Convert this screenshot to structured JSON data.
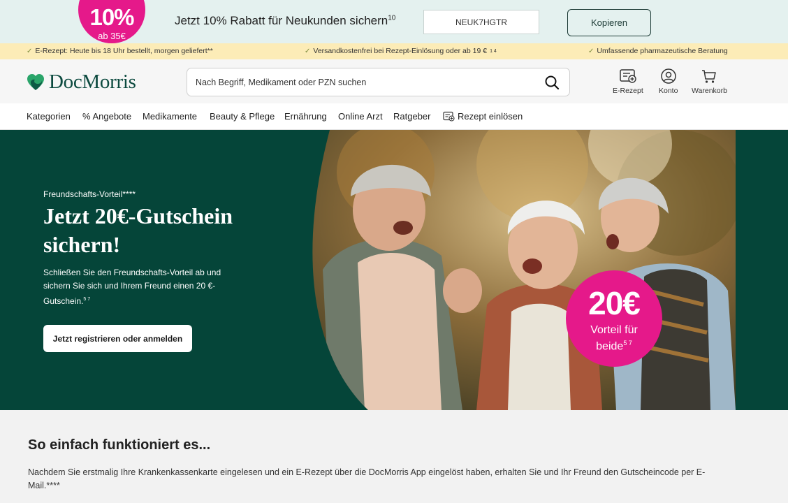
{
  "promo": {
    "badge_big": "10%",
    "badge_small": "ab 35€",
    "text": "Jetzt 10% Rabatt für Neukunden sichern",
    "text_sup": "10",
    "code": "NEUK7HGTR",
    "copy_label": "Kopieren"
  },
  "usp": {
    "items": [
      {
        "text": "E-Rezept: Heute bis 18 Uhr bestellt, morgen geliefert**",
        "sup": ""
      },
      {
        "text": "Versandkostenfrei bei Rezept-Einlösung oder ab 19 €",
        "sup": "1 4"
      },
      {
        "text": "Umfassende pharmazeutische Beratung",
        "sup": ""
      }
    ]
  },
  "header": {
    "logo": "DocMorris",
    "search_placeholder": "Nach Begriff, Medikament oder PZN suchen",
    "actions": {
      "erezept": "E-Rezept",
      "konto": "Konto",
      "warenkorb": "Warenkorb"
    }
  },
  "nav": {
    "items": [
      "Kategorien",
      "% Angebote",
      "Medikamente",
      "Beauty & Pflege",
      "Ernährung",
      "Online Arzt",
      "Ratgeber",
      "Rezept einlösen"
    ]
  },
  "hero": {
    "eyebrow": "Freundschafts-Vorteil****",
    "title": "Jetzt 20€-Gutschein sichern!",
    "text": "Schließen Sie den Freundschafts-Vorteil ab und sichern Sie sich und Ihrem Freund einen 20 €-Gutschein.",
    "text_sup": "5 7",
    "button": "Jetzt registrieren oder anmelden",
    "badge_amount": "20€",
    "badge_line1": "Vorteil für",
    "badge_line2": "beide",
    "badge_sup": "5 7"
  },
  "how": {
    "title": "So einfach funktioniert es...",
    "text": "Nachdem Sie erstmalig Ihre Krankenkassenkarte eingelesen und ein E-Rezept über die DocMorris App eingelöst haben, erhalten Sie und Ihr Freund den Gutscheincode per E-Mail.****"
  },
  "colors": {
    "brand_green": "#054539",
    "accent_pink": "#e5198a",
    "promo_bg": "#e4f1ef",
    "usp_bg": "#fcecb7"
  },
  "icons": [
    "heart-logo-icon",
    "search-icon",
    "e-rezept-icon",
    "account-icon",
    "cart-icon",
    "prescription-icon",
    "check-icon"
  ]
}
